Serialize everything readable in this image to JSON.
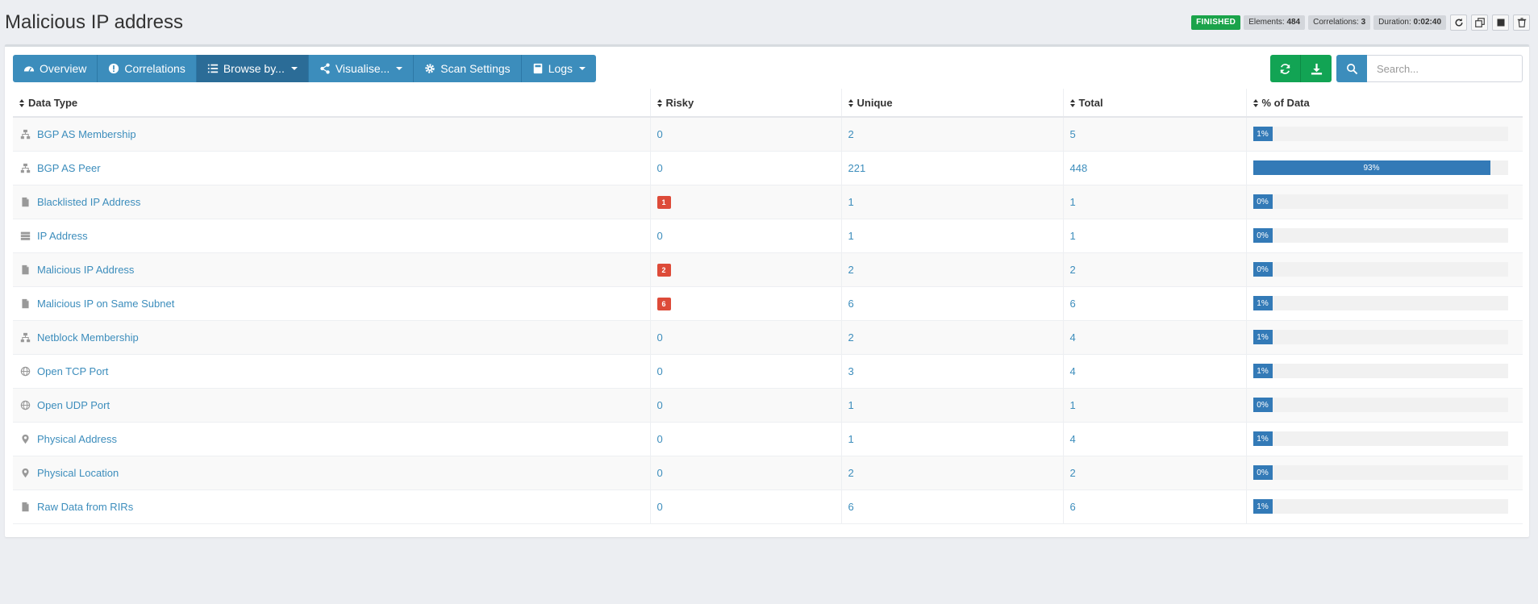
{
  "page": {
    "title": "Malicious IP address"
  },
  "status": {
    "state": "FINISHED",
    "elements_label": "Elements:",
    "elements_value": "484",
    "correlations_label": "Correlations:",
    "correlations_value": "3",
    "duration_label": "Duration:",
    "duration_value": "0:02:40",
    "buttons": [
      "refresh-icon",
      "clone-icon",
      "stop-icon",
      "delete-icon"
    ]
  },
  "toolbar": {
    "tabs": [
      {
        "label": "Overview",
        "icon": "dashboard-icon"
      },
      {
        "label": "Correlations",
        "icon": "alert-icon"
      },
      {
        "label": "Browse by...",
        "icon": "list-icon",
        "dropdown": true,
        "active": true
      },
      {
        "label": "Visualise...",
        "icon": "share-icon",
        "dropdown": true
      },
      {
        "label": "Scan Settings",
        "icon": "gear-icon"
      },
      {
        "label": "Logs",
        "icon": "book-icon",
        "dropdown": true
      }
    ],
    "refresh_icon": "refresh-icon",
    "download_icon": "download-icon",
    "search_icon": "search-icon",
    "search_placeholder": "Search..."
  },
  "table": {
    "headers": [
      "Data Type",
      "Risky",
      "Unique",
      "Total",
      "% of Data"
    ],
    "rows": [
      {
        "type": "BGP AS Membership",
        "icon": "network-icon",
        "risky": "0",
        "unique": "2",
        "total": "5",
        "pct": "1%",
        "fraction": 0.01
      },
      {
        "type": "BGP AS Peer",
        "icon": "network-icon",
        "risky": "0",
        "unique": "221",
        "total": "448",
        "pct": "93%",
        "fraction": 0.93
      },
      {
        "type": "Blacklisted IP Address",
        "icon": "file-icon",
        "risky": "1",
        "unique": "1",
        "total": "1",
        "pct": "0%",
        "fraction": 0.0
      },
      {
        "type": "IP Address",
        "icon": "server-icon",
        "risky": "0",
        "unique": "1",
        "total": "1",
        "pct": "0%",
        "fraction": 0.0
      },
      {
        "type": "Malicious IP Address",
        "icon": "file-icon",
        "risky": "2",
        "unique": "2",
        "total": "2",
        "pct": "0%",
        "fraction": 0.0
      },
      {
        "type": "Malicious IP on Same Subnet",
        "icon": "file-icon",
        "risky": "6",
        "unique": "6",
        "total": "6",
        "pct": "1%",
        "fraction": 0.01
      },
      {
        "type": "Netblock Membership",
        "icon": "network-icon",
        "risky": "0",
        "unique": "2",
        "total": "4",
        "pct": "1%",
        "fraction": 0.01
      },
      {
        "type": "Open TCP Port",
        "icon": "globe-icon",
        "risky": "0",
        "unique": "3",
        "total": "4",
        "pct": "1%",
        "fraction": 0.01
      },
      {
        "type": "Open UDP Port",
        "icon": "globe-icon",
        "risky": "0",
        "unique": "1",
        "total": "1",
        "pct": "0%",
        "fraction": 0.0
      },
      {
        "type": "Physical Address",
        "icon": "map-marker-icon",
        "risky": "0",
        "unique": "1",
        "total": "4",
        "pct": "1%",
        "fraction": 0.01
      },
      {
        "type": "Physical Location",
        "icon": "map-marker-icon",
        "risky": "0",
        "unique": "2",
        "total": "2",
        "pct": "0%",
        "fraction": 0.0
      },
      {
        "type": "Raw Data from RIRs",
        "icon": "file-icon",
        "risky": "0",
        "unique": "6",
        "total": "6",
        "pct": "1%",
        "fraction": 0.01
      }
    ]
  },
  "colors": {
    "primary": "#3c8dbc",
    "success": "#12a454",
    "danger": "#dd4b39",
    "bar": "#337ab7"
  }
}
